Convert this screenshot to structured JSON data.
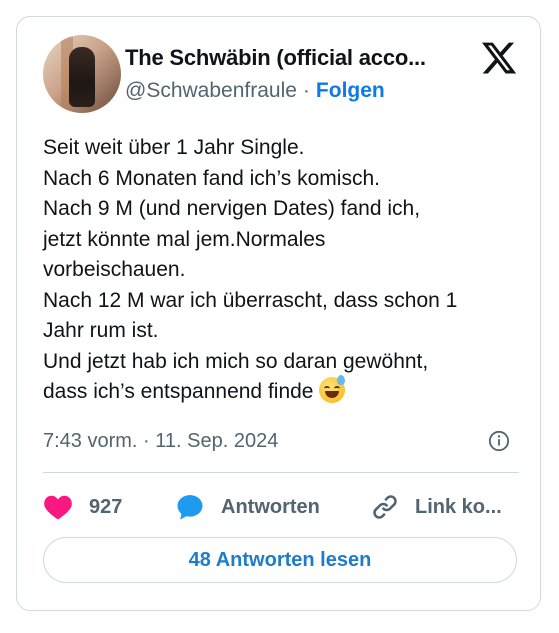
{
  "author": {
    "name": "The Schwäbin (official acco...",
    "handle": "@Schwabenfraule",
    "separator": "·",
    "follow_label": "Folgen"
  },
  "tweet": {
    "lines": [
      "Seit weit über 1 Jahr Single.",
      "Nach 6 Monaten fand ich’s komisch.",
      "Nach 9 M (und nervigen Dates) fand ich,",
      "jetzt könnte mal jem.Normales",
      "vorbeischauen.",
      "Nach 12 M war ich überrascht, dass schon 1",
      "Jahr rum ist.",
      "Und jetzt hab ich mich so daran gewöhnt,",
      "dass ich’s entspannend finde"
    ],
    "emoji": "sweat-smile-emoji",
    "timestamp": "7:43 vorm. · 11. Sep. 2024"
  },
  "actions": {
    "likes": "927",
    "reply_label": "Antworten",
    "link_label": "Link ko..."
  },
  "read_replies_label": "48 Antworten lesen",
  "icons": {
    "logo": "x-logo-icon",
    "info": "info-icon",
    "like": "heart-icon",
    "reply": "speech-bubble-icon",
    "link": "link-icon"
  },
  "colors": {
    "accent": "#1d9bf0",
    "like": "#f91880",
    "text": "#0f1419",
    "muted": "#536471",
    "border": "#cfd9de"
  }
}
